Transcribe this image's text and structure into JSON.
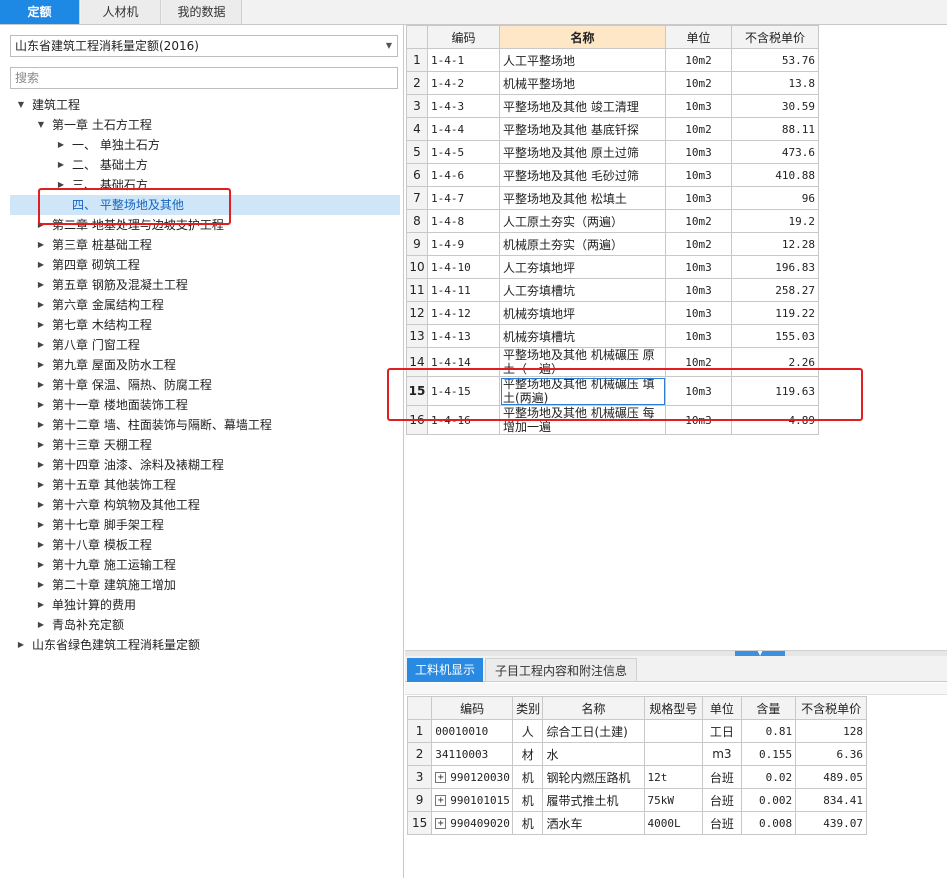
{
  "top_tabs": [
    {
      "label": "定额",
      "active": true
    },
    {
      "label": "人材机",
      "active": false
    },
    {
      "label": "我的数据",
      "active": false
    }
  ],
  "left": {
    "library_select": "山东省建筑工程消耗量定额(2016)",
    "search_placeholder": "搜索",
    "tree": [
      {
        "label": "建筑工程",
        "level": 0,
        "arrow": "▼"
      },
      {
        "label": "第一章 土石方工程",
        "level": 1,
        "arrow": "▼"
      },
      {
        "label": "一、 单独土石方",
        "level": 2,
        "arrow": "▶"
      },
      {
        "label": "二、 基础土方",
        "level": 2,
        "arrow": "▶"
      },
      {
        "label": "三、 基础石方",
        "level": 2,
        "arrow": "▶"
      },
      {
        "label": "四、 平整场地及其他",
        "level": 2,
        "arrow": "",
        "selected": true
      },
      {
        "label": "第二章 地基处理与边坡支护工程",
        "level": 1,
        "arrow": "▶"
      },
      {
        "label": "第三章 桩基础工程",
        "level": 1,
        "arrow": "▶"
      },
      {
        "label": "第四章 砌筑工程",
        "level": 1,
        "arrow": "▶"
      },
      {
        "label": "第五章 钢筋及混凝土工程",
        "level": 1,
        "arrow": "▶"
      },
      {
        "label": "第六章 金属结构工程",
        "level": 1,
        "arrow": "▶"
      },
      {
        "label": "第七章 木结构工程",
        "level": 1,
        "arrow": "▶"
      },
      {
        "label": "第八章 门窗工程",
        "level": 1,
        "arrow": "▶"
      },
      {
        "label": "第九章 屋面及防水工程",
        "level": 1,
        "arrow": "▶"
      },
      {
        "label": "第十章 保温、隔热、防腐工程",
        "level": 1,
        "arrow": "▶"
      },
      {
        "label": "第十一章 楼地面装饰工程",
        "level": 1,
        "arrow": "▶"
      },
      {
        "label": "第十二章 墙、柱面装饰与隔断、幕墙工程",
        "level": 1,
        "arrow": "▶"
      },
      {
        "label": "第十三章 天棚工程",
        "level": 1,
        "arrow": "▶"
      },
      {
        "label": "第十四章 油漆、涂料及裱糊工程",
        "level": 1,
        "arrow": "▶"
      },
      {
        "label": "第十五章 其他装饰工程",
        "level": 1,
        "arrow": "▶"
      },
      {
        "label": "第十六章 构筑物及其他工程",
        "level": 1,
        "arrow": "▶"
      },
      {
        "label": "第十七章 脚手架工程",
        "level": 1,
        "arrow": "▶"
      },
      {
        "label": "第十八章 模板工程",
        "level": 1,
        "arrow": "▶"
      },
      {
        "label": "第十九章 施工运输工程",
        "level": 1,
        "arrow": "▶"
      },
      {
        "label": "第二十章 建筑施工增加",
        "level": 1,
        "arrow": "▶"
      },
      {
        "label": "单独计算的费用",
        "level": 1,
        "arrow": "▶"
      },
      {
        "label": "青岛补充定额",
        "level": 1,
        "arrow": "▶"
      },
      {
        "label": "山东省绿色建筑工程消耗量定额",
        "level": 0,
        "arrow": "▶"
      }
    ]
  },
  "quota_table": {
    "headers": [
      "",
      "编码",
      "名称",
      "单位",
      "不含税单价"
    ],
    "rows": [
      {
        "n": "1",
        "code": "1-4-1",
        "name": "人工平整场地",
        "unit": "10m2",
        "price": "53.76"
      },
      {
        "n": "2",
        "code": "1-4-2",
        "name": "机械平整场地",
        "unit": "10m2",
        "price": "13.8"
      },
      {
        "n": "3",
        "code": "1-4-3",
        "name": "平整场地及其他 竣工清理",
        "unit": "10m3",
        "price": "30.59"
      },
      {
        "n": "4",
        "code": "1-4-4",
        "name": "平整场地及其他 基底钎探",
        "unit": "10m2",
        "price": "88.11"
      },
      {
        "n": "5",
        "code": "1-4-5",
        "name": "平整场地及其他 原土过筛",
        "unit": "10m3",
        "price": "473.6"
      },
      {
        "n": "6",
        "code": "1-4-6",
        "name": "平整场地及其他 毛砂过筛",
        "unit": "10m3",
        "price": "410.88"
      },
      {
        "n": "7",
        "code": "1-4-7",
        "name": "平整场地及其他 松填土",
        "unit": "10m3",
        "price": "96"
      },
      {
        "n": "8",
        "code": "1-4-8",
        "name": "人工原土夯实（两遍）",
        "unit": "10m2",
        "price": "19.2"
      },
      {
        "n": "9",
        "code": "1-4-9",
        "name": "机械原土夯实（两遍）",
        "unit": "10m2",
        "price": "12.28"
      },
      {
        "n": "10",
        "code": "1-4-10",
        "name": "人工夯填地坪",
        "unit": "10m3",
        "price": "196.83"
      },
      {
        "n": "11",
        "code": "1-4-11",
        "name": "人工夯填槽坑",
        "unit": "10m3",
        "price": "258.27"
      },
      {
        "n": "12",
        "code": "1-4-12",
        "name": "机械夯填地坪",
        "unit": "10m3",
        "price": "119.22"
      },
      {
        "n": "13",
        "code": "1-4-13",
        "name": "机械夯填槽坑",
        "unit": "10m3",
        "price": "155.03"
      },
      {
        "n": "14",
        "code": "1-4-14",
        "name": "平整场地及其他 机械碾压 原土（一遍）",
        "unit": "10m2",
        "price": "2.26"
      },
      {
        "n": "15",
        "code": "1-4-15",
        "name": "平整场地及其他 机械碾压 填土(两遍)",
        "unit": "10m3",
        "price": "119.63"
      },
      {
        "n": "16",
        "code": "1-4-16",
        "name": "平整场地及其他 机械碾压 每增加一遍",
        "unit": "10m3",
        "price": "4.89"
      }
    ]
  },
  "bottom": {
    "tabs": [
      {
        "label": "工料机显示",
        "active": true
      },
      {
        "label": "子目工程内容和附注信息",
        "active": false
      }
    ],
    "headers": [
      "",
      "编码",
      "类别",
      "名称",
      "规格型号",
      "单位",
      "含量",
      "不含税单价"
    ],
    "rows": [
      {
        "n": "1",
        "expand": false,
        "code": "00010010",
        "type": "人",
        "name": "综合工日(土建)",
        "spec": "",
        "unit": "工日",
        "qty": "0.81",
        "price": "128"
      },
      {
        "n": "2",
        "expand": false,
        "code": "34110003",
        "type": "材",
        "name": "水",
        "spec": "",
        "unit": "m3",
        "qty": "0.155",
        "price": "6.36"
      },
      {
        "n": "3",
        "expand": true,
        "code": "990120030",
        "type": "机",
        "name": "钢轮内燃压路机",
        "spec": "12t",
        "unit": "台班",
        "qty": "0.02",
        "price": "489.05"
      },
      {
        "n": "9",
        "expand": true,
        "code": "990101015",
        "type": "机",
        "name": "履带式推土机",
        "spec": "75kW",
        "unit": "台班",
        "qty": "0.002",
        "price": "834.41"
      },
      {
        "n": "15",
        "expand": true,
        "code": "990409020",
        "type": "机",
        "name": "洒水车",
        "spec": "4000L",
        "unit": "台班",
        "qty": "0.008",
        "price": "439.07"
      }
    ]
  },
  "icons": {
    "tree_expanded": "caret-down-icon",
    "tree_collapsed": "caret-right-icon",
    "expander": "plus-box-icon"
  },
  "colors": {
    "accent": "#1e88e5",
    "highlight_box": "#e02020",
    "selection": "#cfe6f8",
    "header_highlight": "#fde7c6"
  }
}
